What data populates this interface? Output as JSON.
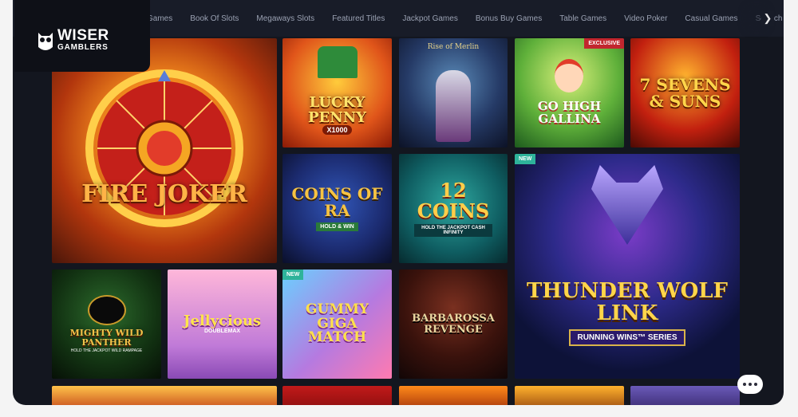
{
  "nav": {
    "items": [
      "Games",
      "Book Of Slots",
      "Megaways Slots",
      "Featured Titles",
      "Jackpot Games",
      "Bonus Buy Games",
      "Table Games",
      "Video Poker",
      "Casual Games",
      "Scratch Gu"
    ],
    "next_icon": "chevron-right-icon"
  },
  "logo": {
    "line1": "WISER",
    "line2": "GAMBLERS"
  },
  "tiles": {
    "fire_joker": {
      "title": "FIRE JOKER"
    },
    "lucky_penny": {
      "title": "LUCKY PENNY",
      "sub": "X1000"
    },
    "rise_of_merlin": {
      "title": "Rise of Merlin"
    },
    "go_high_gallina": {
      "title": "GO HIGH GALLINA",
      "badge": "EXCLUSIVE"
    },
    "sevens_suns": {
      "title": "7 SEVENS & SUNS"
    },
    "coins_ra": {
      "title": "COINS OF RA",
      "sub": "HOLD & WIN"
    },
    "twelve_coins": {
      "title": "12 COINS",
      "sub": "HOLD THE JACKPOT CASH INFINITY"
    },
    "thunder_wolf": {
      "title": "THUNDER WOLF LINK",
      "sub": "RUNNING WINS™ SERIES",
      "badge": "NEW"
    },
    "mighty_wild": {
      "title": "MIGHTY WILD PANTHER",
      "sub": "HOLD THE JACKPOT WILD RAMPAGE"
    },
    "jellycious": {
      "title": "Jellycious",
      "sub": "DOUBLEMAX"
    },
    "gummy": {
      "title": "GUMMY GIGA MATCH",
      "badge": "NEW"
    },
    "barbarossa": {
      "title": "BARBAROSSA REVENGE"
    }
  },
  "colors": {
    "bg": "#13161f",
    "nav": "#181c28",
    "new_badge": "#2eb39a",
    "exclusive_badge": "#c2262e"
  },
  "chat_icon": "chat-bubble-icon"
}
